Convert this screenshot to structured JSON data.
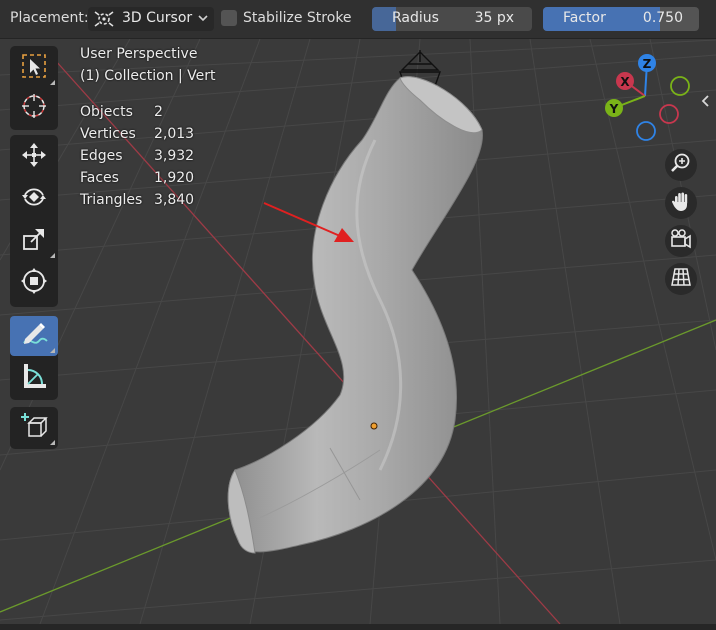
{
  "header": {
    "placement_label": "Placement:",
    "placement_value": "3D Cursor",
    "stabilize_label": "Stabilize Stroke",
    "stabilize_checked": false,
    "radius": {
      "label": "Radius",
      "value": "35 px"
    },
    "factor": {
      "label": "Factor",
      "value": "0.750",
      "fraction": 0.75
    }
  },
  "viewport": {
    "view_name": "User Perspective",
    "collection_info": "(1) Collection | Vert",
    "stats": [
      {
        "label": "Objects",
        "value": "2"
      },
      {
        "label": "Vertices",
        "value": "2,013"
      },
      {
        "label": "Edges",
        "value": "3,932"
      },
      {
        "label": "Faces",
        "value": "1,920"
      },
      {
        "label": "Triangles",
        "value": "3,840"
      }
    ]
  },
  "toolbar": {
    "tools": [
      {
        "icon": "select-box-icon"
      },
      {
        "icon": "cursor-icon"
      },
      {
        "icon": "move-icon"
      },
      {
        "icon": "rotate-icon"
      },
      {
        "icon": "scale-icon"
      },
      {
        "icon": "transform-icon"
      },
      {
        "icon": "annotate-icon",
        "active": true
      },
      {
        "icon": "measure-icon"
      },
      {
        "icon": "add-cube-icon"
      }
    ]
  },
  "gizmo": {
    "x_label": "X",
    "y_label": "Y",
    "z_label": "Z",
    "colors": {
      "x": "#c8374e",
      "y": "#7ab318",
      "z": "#2f83e6"
    }
  },
  "nav_buttons": [
    "zoom-icon",
    "hand-pan-icon",
    "camera-icon",
    "grid-toggle-icon"
  ],
  "colors": {
    "accent": "#4772b3",
    "x_axis": "#9e3a46",
    "y_axis": "#6b9a2c",
    "annotation": "#e02020"
  }
}
